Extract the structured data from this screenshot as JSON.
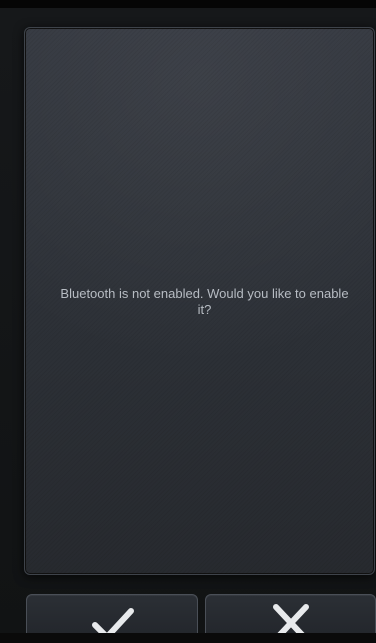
{
  "dialog": {
    "message": "Bluetooth is not enabled. Would you like to enable it?"
  },
  "buttons": {
    "confirm_icon": "checkmark-icon",
    "cancel_icon": "close-icon"
  }
}
